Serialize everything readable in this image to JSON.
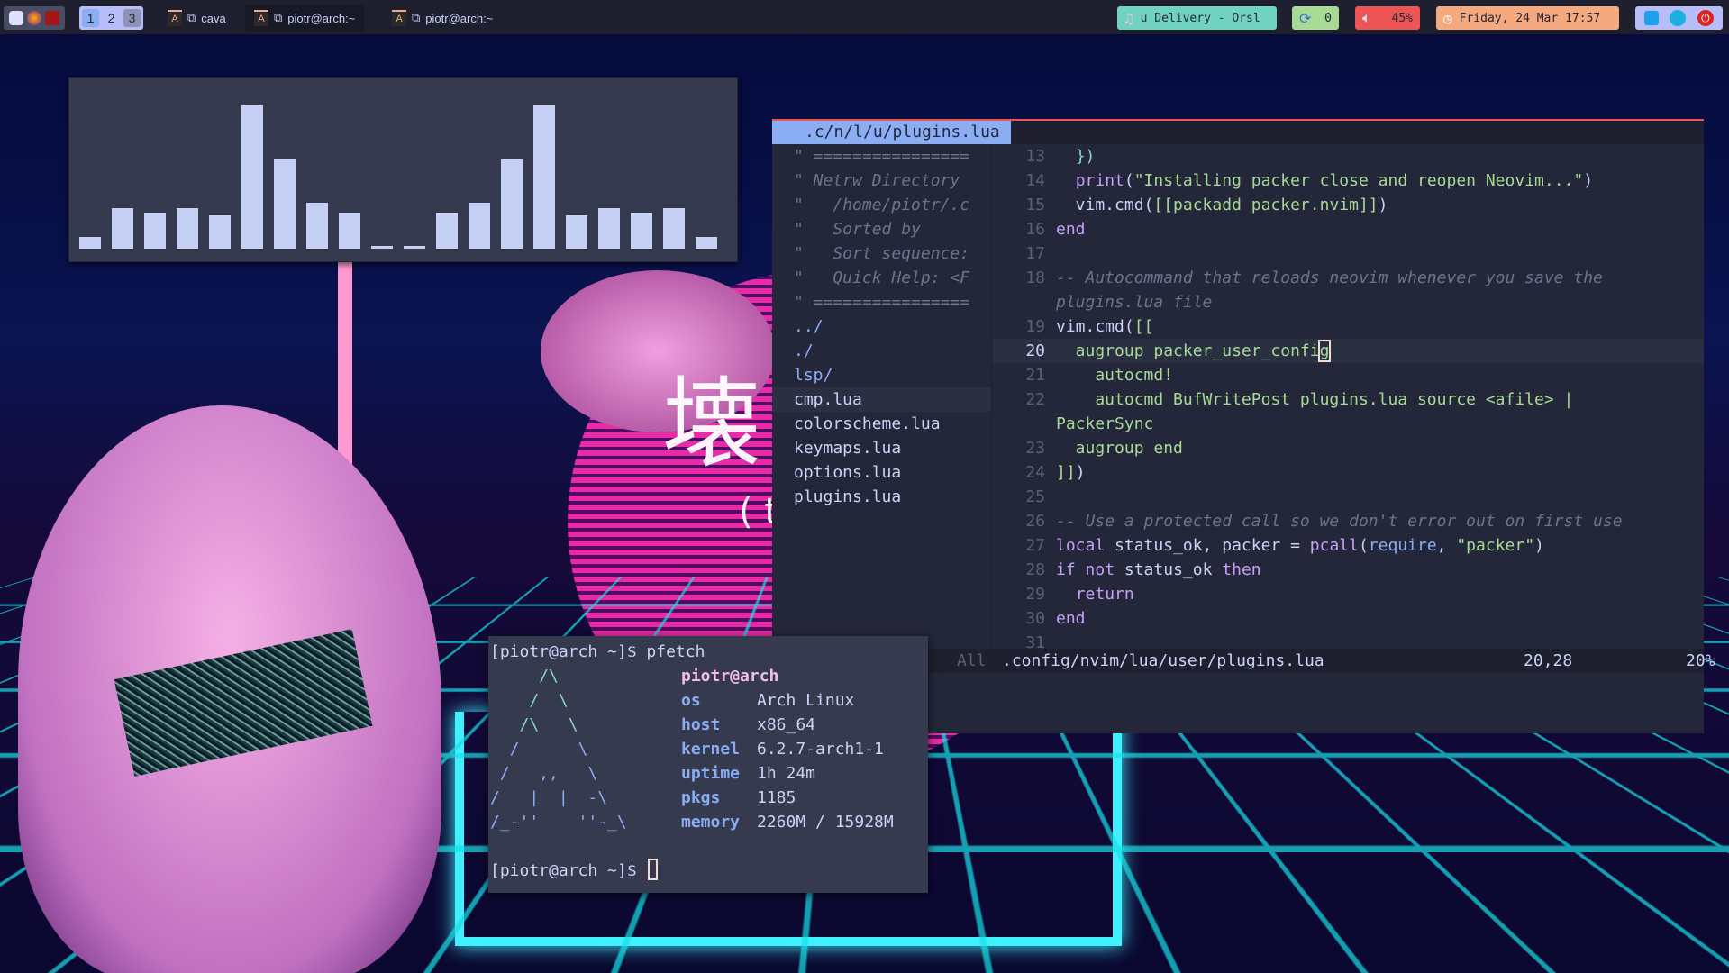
{
  "topbar": {
    "launchers": [
      "discord-icon",
      "firefox-icon",
      "app-icon"
    ],
    "workspaces": [
      "1",
      "2",
      "3"
    ],
    "tasks": [
      {
        "label": "cava"
      },
      {
        "label": "piotr@arch:~"
      },
      {
        "label": "piotr@arch:~"
      }
    ],
    "music": "u Delivery - Orsl",
    "updates": "0",
    "volume": "45%",
    "clock": "Friday, 24 Mar 17:57",
    "colors": {
      "music": "#6fd3c0",
      "updates": "#a6da95",
      "volume": "#ed5454",
      "clock": "#f5a97f",
      "tray": "#b7bdf8"
    }
  },
  "background": {
    "kanji": "壊",
    "kanji_sub": "( t"
  },
  "cava": {
    "levels": [
      0.08,
      0.28,
      0.25,
      0.28,
      0.23,
      1.0,
      0.62,
      0.32,
      0.25,
      0.02,
      0.02,
      0.25,
      0.32,
      0.62,
      1.0,
      0.23,
      0.28,
      0.25,
      0.28,
      0.08
    ]
  },
  "editor": {
    "tab": ".c/n/l/u/plugins.lua",
    "netrw": [
      {
        "t": "\" ================",
        "cls": "cm"
      },
      {
        "t": "\" Netrw Directory",
        "cls": "cm"
      },
      {
        "t": "\"   /home/piotr/.c",
        "cls": "cm"
      },
      {
        "t": "\"   Sorted by",
        "cls": "cm"
      },
      {
        "t": "\"   Sort sequence:",
        "cls": "cm"
      },
      {
        "t": "\"   Quick Help: <F",
        "cls": "cm"
      },
      {
        "t": "\" ================",
        "cls": "cm"
      },
      {
        "t": "../",
        "cls": "dir"
      },
      {
        "t": "./",
        "cls": "dir"
      },
      {
        "t": "lsp/",
        "cls": "dir"
      },
      {
        "t": "cmp.lua",
        "cls": "cur"
      },
      {
        "t": "colorscheme.lua",
        "cls": ""
      },
      {
        "t": "keymaps.lua",
        "cls": ""
      },
      {
        "t": "options.lua",
        "cls": ""
      },
      {
        "t": "plugins.lua",
        "cls": ""
      }
    ],
    "lines": [
      {
        "n": "13",
        "tok": [
          [
            "  ",
            "v"
          ],
          [
            "})",
            "p"
          ]
        ]
      },
      {
        "n": "14",
        "tok": [
          [
            "  ",
            "v"
          ],
          [
            "print",
            "k"
          ],
          [
            "(",
            "v"
          ],
          [
            "\"Installing packer close and reopen Neovim...\"",
            "s"
          ],
          [
            ")",
            "v"
          ]
        ]
      },
      {
        "n": "15",
        "tok": [
          [
            "  vim.cmd(",
            "v"
          ],
          [
            "[[packadd packer.nvim]]",
            "s"
          ],
          [
            ")",
            "v"
          ]
        ]
      },
      {
        "n": "16",
        "tok": [
          [
            "end",
            "k"
          ]
        ]
      },
      {
        "n": "17",
        "tok": []
      },
      {
        "n": "18",
        "tok": [
          [
            "-- Autocommand that reloads neovim whenever you save the",
            "c"
          ]
        ]
      },
      {
        "n": "",
        "tok": [
          [
            "plugins.lua file",
            "c"
          ]
        ]
      },
      {
        "n": "19",
        "tok": [
          [
            "vim.cmd(",
            "v"
          ],
          [
            "[[",
            "s"
          ]
        ]
      },
      {
        "n": "20",
        "cur": true,
        "tok": [
          [
            "  augroup packer_user_confi",
            "s"
          ],
          [
            "g",
            "s cursor"
          ]
        ]
      },
      {
        "n": "21",
        "tok": [
          [
            "    autocmd!",
            "s"
          ]
        ]
      },
      {
        "n": "22",
        "tok": [
          [
            "    autocmd BufWritePost plugins.lua source <afile> | ",
            "s"
          ]
        ]
      },
      {
        "n": "",
        "tok": [
          [
            "PackerSync",
            "s"
          ]
        ]
      },
      {
        "n": "23",
        "tok": [
          [
            "  augroup end",
            "s"
          ]
        ]
      },
      {
        "n": "24",
        "tok": [
          [
            "]]",
            "s"
          ],
          [
            ")",
            "v"
          ]
        ]
      },
      {
        "n": "25",
        "tok": []
      },
      {
        "n": "26",
        "tok": [
          [
            "-- Use a protected call so we don't error out on first use",
            "c"
          ]
        ]
      },
      {
        "n": "27",
        "tok": [
          [
            "local",
            "k"
          ],
          [
            " status_ok, packer = ",
            "v"
          ],
          [
            "pcall",
            "k"
          ],
          [
            "(",
            "v"
          ],
          [
            "require",
            "f"
          ],
          [
            ", ",
            "v"
          ],
          [
            "\"packer\"",
            "s"
          ],
          [
            ")",
            "v"
          ]
        ]
      },
      {
        "n": "28",
        "tok": [
          [
            "if",
            "k"
          ],
          [
            " not",
            "k"
          ],
          [
            " status_ok ",
            "v"
          ],
          [
            "then",
            "k"
          ]
        ]
      },
      {
        "n": "29",
        "tok": [
          [
            "  ",
            "v"
          ],
          [
            "return",
            "k"
          ]
        ]
      },
      {
        "n": "30",
        "tok": [
          [
            "end",
            "k"
          ]
        ]
      },
      {
        "n": "31",
        "tok": []
      }
    ],
    "status": {
      "mode": "All",
      "file": ".config/nvim/lua/user/plugins.lua",
      "pos": "20,28",
      "pct": "20%"
    }
  },
  "terminal": {
    "prompt": "[piotr@arch ~]$ ",
    "command": "pfetch",
    "art": [
      "     /\\",
      "    /  \\",
      "   /\\   \\",
      "  /      \\",
      " /   ,,   \\",
      "/   |  |  -\\",
      "/_-''    ''-_\\"
    ],
    "user_host": "piotr@arch",
    "info": [
      {
        "label": "os",
        "value": "Arch Linux"
      },
      {
        "label": "host",
        "value": "x86_64"
      },
      {
        "label": "kernel",
        "value": "6.2.7-arch1-1"
      },
      {
        "label": "uptime",
        "value": "1h 24m"
      },
      {
        "label": "pkgs",
        "value": "1185"
      },
      {
        "label": "memory",
        "value": "2260M / 15928M"
      }
    ]
  }
}
